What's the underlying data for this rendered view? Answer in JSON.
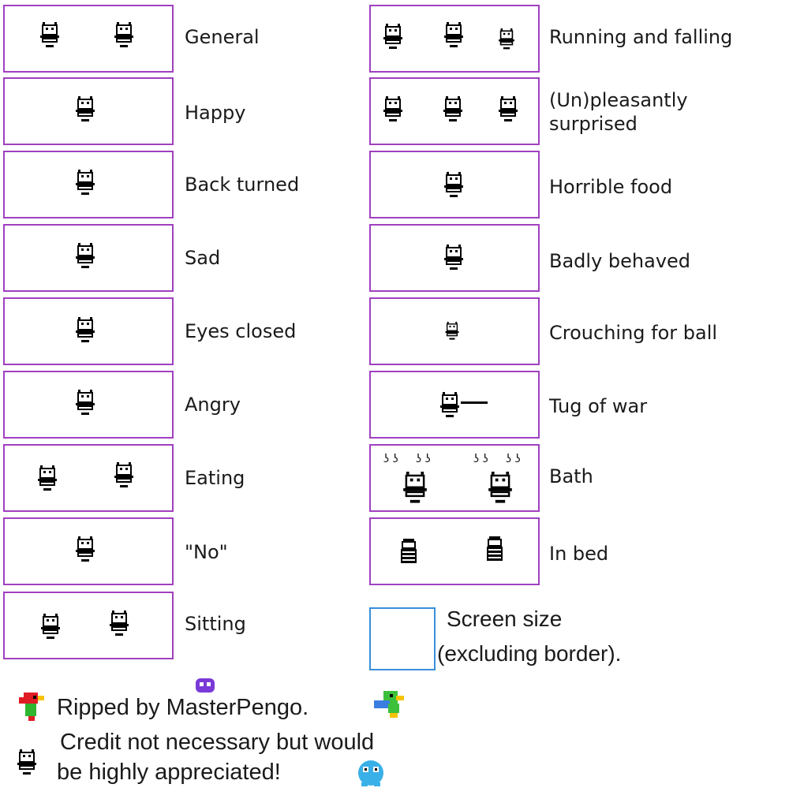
{
  "colors": {
    "box_border": "#a040c0",
    "screen_border": "#3a8fd8",
    "sprite": "#000000"
  },
  "left_column": [
    {
      "label": "General",
      "sprites": 2
    },
    {
      "label": "Happy",
      "sprites": 1
    },
    {
      "label": "Back turned",
      "sprites": 1
    },
    {
      "label": "Sad",
      "sprites": 1
    },
    {
      "label": "Eyes closed",
      "sprites": 1
    },
    {
      "label": "Angry",
      "sprites": 1
    },
    {
      "label": "Eating",
      "sprites": 2
    },
    {
      "label": "\"No\"",
      "sprites": 1
    },
    {
      "label": "Sitting",
      "sprites": 2
    }
  ],
  "right_column": [
    {
      "label": "Running and falling",
      "sprites": 3
    },
    {
      "label": "(Un)pleasantly surprised",
      "sprites": 3
    },
    {
      "label": "Horrible food",
      "sprites": 1
    },
    {
      "label": "Badly behaved",
      "sprites": 1
    },
    {
      "label": "Crouching for ball",
      "sprites": 1
    },
    {
      "label": "Tug of war",
      "sprites": 1
    },
    {
      "label": "Bath",
      "sprites": 2
    },
    {
      "label": "In bed",
      "sprites": 2
    }
  ],
  "screen_note": {
    "line1": "Screen size",
    "line2": "(excluding border)."
  },
  "credits": {
    "line1": "Ripped by MasterPengo.",
    "line2": "Credit not necessary but would",
    "line3": "be highly appreciated!"
  },
  "icons": [
    "red-parrot-icon",
    "purple-blob-icon",
    "green-parrot-icon",
    "pet-face-icon",
    "blue-bird-icon"
  ]
}
